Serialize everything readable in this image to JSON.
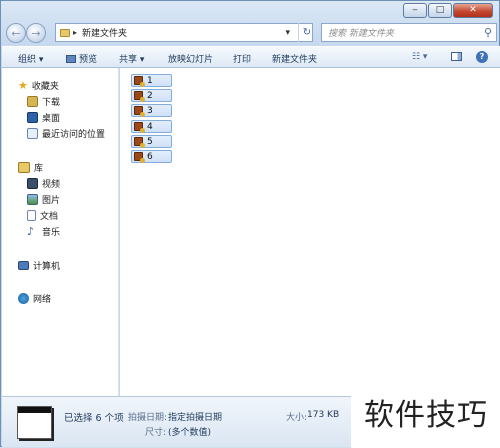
{
  "window": {
    "minimize_glyph": "‒",
    "maximize_glyph": "□",
    "close_glyph": "✕"
  },
  "address": {
    "path": "新建文件夹",
    "arrow_glyph": "▸",
    "dropdown_glyph": "▾",
    "refresh_glyph": "↻"
  },
  "search": {
    "placeholder": "搜索 新建文件夹"
  },
  "toolbar": {
    "organize": "组织 ▾",
    "preview": "预览",
    "share": "共享 ▾",
    "slideshow": "放映幻灯片",
    "print": "打印",
    "new_folder": "新建文件夹"
  },
  "sidebar": {
    "favorites": "收藏夹",
    "download": "下载",
    "desktop": "桌面",
    "recent": "最近访问的位置",
    "library": "库",
    "video": "视频",
    "pictures": "图片",
    "documents": "文档",
    "music": "音乐",
    "computer": "计算机",
    "network": "网络"
  },
  "files": [
    "1",
    "2",
    "3",
    "4",
    "5",
    "6"
  ],
  "status": {
    "selected": "已选择 6 个项",
    "taken_label": "拍摄日期:",
    "taken_value": "指定拍摄日期",
    "size_label": "大小:",
    "size_value": "173 KB",
    "dims_label": "尺寸:",
    "dims_value": "(多个数值)"
  },
  "watermark": "软件技巧",
  "colors": {
    "selection": "#cfe0f6",
    "selection_border": "#84acdd",
    "accent": "#1e395b"
  }
}
